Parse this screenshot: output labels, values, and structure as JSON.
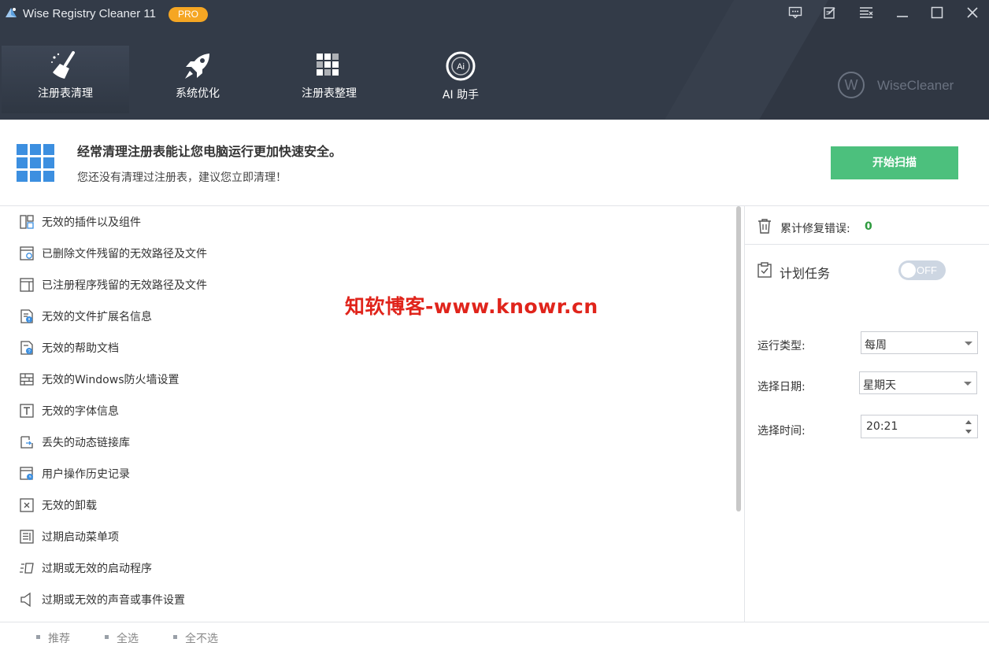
{
  "window": {
    "title": "Wise Registry Cleaner 11",
    "badge": "PRO",
    "brand": "WiseCleaner",
    "brand_mark": "W"
  },
  "nav_tabs": [
    {
      "label": "注册表清理",
      "icon": "broom-icon",
      "active": true
    },
    {
      "label": "系统优化",
      "icon": "rocket-icon",
      "active": false
    },
    {
      "label": "注册表整理",
      "icon": "defrag-grid-icon",
      "active": false
    },
    {
      "label": "AI 助手",
      "icon": "ai-icon",
      "active": false
    }
  ],
  "banner": {
    "title": "经常清理注册表能让您电脑运行更加快速安全。",
    "subtitle": "您还没有清理过注册表，建议您立即清理！",
    "scan_button": "开始扫描"
  },
  "items": [
    {
      "label": "无效的插件以及组件",
      "icon": "component-icon"
    },
    {
      "label": "已删除文件残留的无效路径及文件",
      "icon": "deleted-file-icon"
    },
    {
      "label": "已注册程序残留的无效路径及文件",
      "icon": "program-window-icon"
    },
    {
      "label": "无效的文件扩展名信息",
      "icon": "file-extension-icon"
    },
    {
      "label": "无效的帮助文档",
      "icon": "help-doc-icon"
    },
    {
      "label": "无效的Windows防火墙设置",
      "icon": "firewall-icon"
    },
    {
      "label": "无效的字体信息",
      "icon": "font-icon"
    },
    {
      "label": "丢失的动态链接库",
      "icon": "dll-icon"
    },
    {
      "label": "用户操作历史记录",
      "icon": "history-icon"
    },
    {
      "label": "无效的卸载",
      "icon": "uninstall-icon"
    },
    {
      "label": "过期启动菜单项",
      "icon": "start-menu-icon"
    },
    {
      "label": "过期或无效的启动程序",
      "icon": "startup-icon"
    },
    {
      "label": "过期或无效的声音或事件设置",
      "icon": "sound-icon"
    }
  ],
  "right_panel": {
    "fix_label": "累计修复错误:",
    "fix_count": "0",
    "schedule_label": "计划任务",
    "toggle_label": "OFF",
    "run_type_label": "运行类型:",
    "run_type_value": "每周",
    "date_label": "选择日期:",
    "date_value": "星期天",
    "time_label": "选择时间:",
    "time_value": "20:21"
  },
  "footer": {
    "recommend": "推荐",
    "select_all": "全选",
    "select_none": "全不选"
  },
  "watermark": "知软博客-www.knowr.cn",
  "colors": {
    "header_bg": "#333b48",
    "accent_green": "#4cc07d",
    "badge_orange": "#f5a623",
    "count_green": "#2f9b3f",
    "icon_blue": "#3c8fe0",
    "watermark_red": "#e0241b"
  }
}
